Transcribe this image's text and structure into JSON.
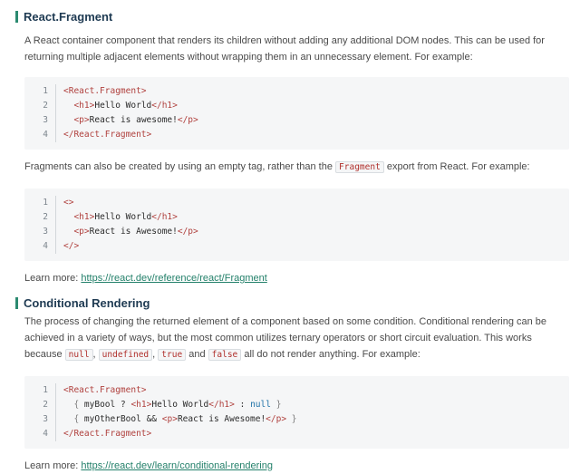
{
  "sections": [
    {
      "title": "React.Fragment",
      "description": "A React container component that renders its children without adding any additional DOM nodes. This can be used for returning multiple adjacent elements without wrapping them in an unnecessary element. For example:",
      "code1": {
        "line_numbers": [
          "1",
          "2",
          "3",
          "4"
        ],
        "open_tag": "<React.Fragment>",
        "h1_open": "<h1>",
        "h1_text": "Hello World",
        "h1_close": "</h1>",
        "p_open": "<p>",
        "p_text": "React is awesome!",
        "p_close": "</p>",
        "close_tag": "</React.Fragment>"
      },
      "middle_text_before": "Fragments can also be created by using an empty tag, rather than the",
      "middle_code": "Fragment",
      "middle_text_after": "export from React. For example:",
      "code2": {
        "line_numbers": [
          "1",
          "2",
          "3",
          "4"
        ],
        "open_tag": "<>",
        "h1_open": "<h1>",
        "h1_text": "Hello World",
        "h1_close": "</h1>",
        "p_open": "<p>",
        "p_text": "React is Awesome!",
        "p_close": "</p>",
        "close_tag": "</>"
      },
      "learn_more_label": "Learn more:",
      "learn_more_url": "https://react.dev/reference/react/Fragment"
    },
    {
      "title": "Conditional Rendering",
      "description": "The process of changing the returned element of a component based on some condition. Conditional rendering can be achieved in a variety of ways, but the most common utilizes ternary operators or short circuit evaluation. This works because",
      "falsy_values": [
        "null",
        "undefined",
        "true",
        "false"
      ],
      "and_word": "and",
      "description_end": "all do not render anything. For example:",
      "code": {
        "line_numbers": [
          "1",
          "2",
          "3",
          "4"
        ],
        "open_tag": "<React.Fragment>",
        "line2_var": "myBool",
        "q": "?",
        "h1_open": "<h1>",
        "h1_text": "Hello World",
        "h1_close": "</h1>",
        "colon": ":",
        "null_kw": "null",
        "line3_var": "myOtherBool",
        "and_op": "&&",
        "p_open": "<p>",
        "p_text": "React is Awesome!",
        "p_close": "</p>",
        "close_tag": "</React.Fragment>"
      },
      "learn_more_label": "Learn more:",
      "learn_more_url": "https://react.dev/learn/conditional-rendering"
    }
  ]
}
